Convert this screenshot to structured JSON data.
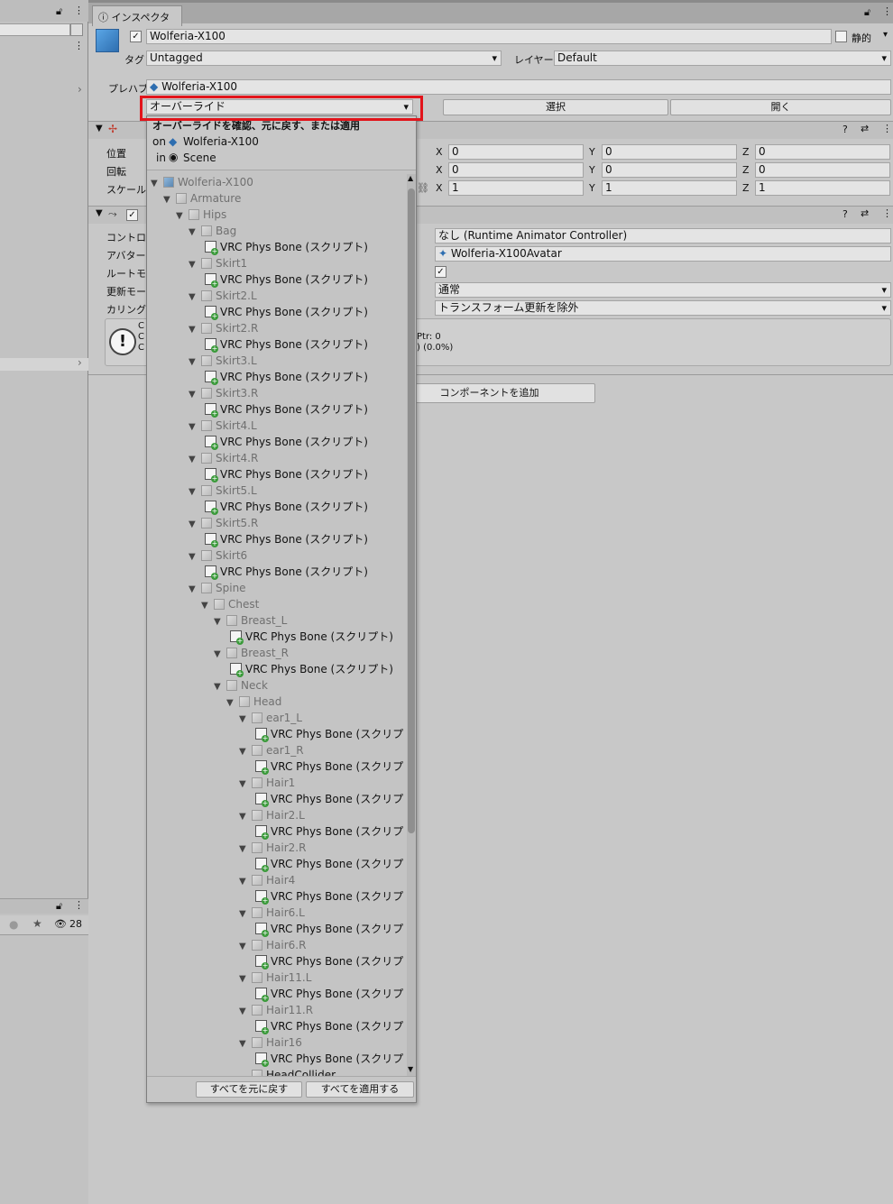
{
  "left": {
    "badge_count": "28"
  },
  "inspector": {
    "tab_label": "インスペクター",
    "object": {
      "name": "Wolferia-X100",
      "static_label": "静的"
    },
    "tag": {
      "label": "タグ",
      "value": "Untagged"
    },
    "layer": {
      "label": "レイヤー",
      "value": "Default"
    },
    "prefab": {
      "label": "プレハブ",
      "value": "Wolferia-X100",
      "overrides_label": "オーバーライド",
      "select_label": "選択",
      "open_label": "開く"
    },
    "transform": {
      "position_label": "位置",
      "rotation_label": "回転",
      "scale_label": "スケール",
      "position": [
        "0",
        "0",
        "0"
      ],
      "rotation": [
        "0",
        "0",
        "0"
      ],
      "scale": [
        "1",
        "1",
        "1"
      ],
      "axis_labels": [
        "X",
        "Y",
        "Z"
      ]
    },
    "animator": {
      "controller_label": "コントロー",
      "controller_value": "なし (Runtime Animator Controller)",
      "avatar_label": "アバター",
      "avatar_value": "Wolferia-X100Avatar",
      "root_motion_label": "ルートモー",
      "update_mode_label": "更新モー",
      "update_mode_value": "通常",
      "culling_label": "カリングモ",
      "culling_value": "トランスフォーム更新を除外",
      "info_text": [
        "C",
        "C",
        "C"
      ],
      "info_right": [
        "Ptr: 0",
        ") (0.0%)"
      ]
    },
    "add_component_label": "コンポーネントを追加"
  },
  "popup": {
    "heading": "オーバーライドを確認、元に戻す、または適用",
    "on_prefix": "on",
    "on_value": "Wolferia-X100",
    "in_prefix": "in",
    "in_value": "Scene",
    "revert_all_label": "すべてを元に戻す",
    "apply_all_label": "すべてを適用する",
    "tree": [
      {
        "depth": 0,
        "kind": "prefab",
        "label": "Wolferia-X100",
        "gray": true
      },
      {
        "depth": 1,
        "kind": "node",
        "label": "Armature",
        "gray": true
      },
      {
        "depth": 2,
        "kind": "node",
        "label": "Hips",
        "gray": true
      },
      {
        "depth": 3,
        "kind": "node",
        "label": "Bag",
        "gray": true
      },
      {
        "depth": 4,
        "kind": "script",
        "label": "VRC Phys Bone (スクリプト)"
      },
      {
        "depth": 3,
        "kind": "node",
        "label": "Skirt1",
        "gray": true
      },
      {
        "depth": 4,
        "kind": "script",
        "label": "VRC Phys Bone (スクリプト)"
      },
      {
        "depth": 3,
        "kind": "node",
        "label": "Skirt2.L",
        "gray": true
      },
      {
        "depth": 4,
        "kind": "script",
        "label": "VRC Phys Bone (スクリプト)"
      },
      {
        "depth": 3,
        "kind": "node",
        "label": "Skirt2.R",
        "gray": true
      },
      {
        "depth": 4,
        "kind": "script",
        "label": "VRC Phys Bone (スクリプト)"
      },
      {
        "depth": 3,
        "kind": "node",
        "label": "Skirt3.L",
        "gray": true
      },
      {
        "depth": 4,
        "kind": "script",
        "label": "VRC Phys Bone (スクリプト)"
      },
      {
        "depth": 3,
        "kind": "node",
        "label": "Skirt3.R",
        "gray": true
      },
      {
        "depth": 4,
        "kind": "script",
        "label": "VRC Phys Bone (スクリプト)"
      },
      {
        "depth": 3,
        "kind": "node",
        "label": "Skirt4.L",
        "gray": true
      },
      {
        "depth": 4,
        "kind": "script",
        "label": "VRC Phys Bone (スクリプト)"
      },
      {
        "depth": 3,
        "kind": "node",
        "label": "Skirt4.R",
        "gray": true
      },
      {
        "depth": 4,
        "kind": "script",
        "label": "VRC Phys Bone (スクリプト)"
      },
      {
        "depth": 3,
        "kind": "node",
        "label": "Skirt5.L",
        "gray": true
      },
      {
        "depth": 4,
        "kind": "script",
        "label": "VRC Phys Bone (スクリプト)"
      },
      {
        "depth": 3,
        "kind": "node",
        "label": "Skirt5.R",
        "gray": true
      },
      {
        "depth": 4,
        "kind": "script",
        "label": "VRC Phys Bone (スクリプト)"
      },
      {
        "depth": 3,
        "kind": "node",
        "label": "Skirt6",
        "gray": true
      },
      {
        "depth": 4,
        "kind": "script",
        "label": "VRC Phys Bone (スクリプト)"
      },
      {
        "depth": 3,
        "kind": "node",
        "label": "Spine",
        "gray": true
      },
      {
        "depth": 4,
        "kind": "node",
        "label": "Chest",
        "gray": true
      },
      {
        "depth": 5,
        "kind": "node",
        "label": "Breast_L",
        "gray": true
      },
      {
        "depth": 6,
        "kind": "script",
        "label": "VRC Phys Bone (スクリプト)"
      },
      {
        "depth": 5,
        "kind": "node",
        "label": "Breast_R",
        "gray": true
      },
      {
        "depth": 6,
        "kind": "script",
        "label": "VRC Phys Bone (スクリプト)"
      },
      {
        "depth": 5,
        "kind": "node",
        "label": "Neck",
        "gray": true
      },
      {
        "depth": 6,
        "kind": "node",
        "label": "Head",
        "gray": true
      },
      {
        "depth": 7,
        "kind": "node",
        "label": "ear1_L",
        "gray": true
      },
      {
        "depth": 8,
        "kind": "script",
        "label": "VRC Phys Bone (スクリプト"
      },
      {
        "depth": 7,
        "kind": "node",
        "label": "ear1_R",
        "gray": true
      },
      {
        "depth": 8,
        "kind": "script",
        "label": "VRC Phys Bone (スクリプト"
      },
      {
        "depth": 7,
        "kind": "node",
        "label": "Hair1",
        "gray": true
      },
      {
        "depth": 8,
        "kind": "script",
        "label": "VRC Phys Bone (スクリプト"
      },
      {
        "depth": 7,
        "kind": "node",
        "label": "Hair2.L",
        "gray": true
      },
      {
        "depth": 8,
        "kind": "script",
        "label": "VRC Phys Bone (スクリプト"
      },
      {
        "depth": 7,
        "kind": "node",
        "label": "Hair2.R",
        "gray": true
      },
      {
        "depth": 8,
        "kind": "script",
        "label": "VRC Phys Bone (スクリプト"
      },
      {
        "depth": 7,
        "kind": "node",
        "label": "Hair4",
        "gray": true
      },
      {
        "depth": 8,
        "kind": "script",
        "label": "VRC Phys Bone (スクリプト"
      },
      {
        "depth": 7,
        "kind": "node",
        "label": "Hair6.L",
        "gray": true
      },
      {
        "depth": 8,
        "kind": "script",
        "label": "VRC Phys Bone (スクリプト"
      },
      {
        "depth": 7,
        "kind": "node",
        "label": "Hair6.R",
        "gray": true
      },
      {
        "depth": 8,
        "kind": "script",
        "label": "VRC Phys Bone (スクリプト"
      },
      {
        "depth": 7,
        "kind": "node",
        "label": "Hair11.L",
        "gray": true
      },
      {
        "depth": 8,
        "kind": "script",
        "label": "VRC Phys Bone (スクリプト"
      },
      {
        "depth": 7,
        "kind": "node",
        "label": "Hair11.R",
        "gray": true
      },
      {
        "depth": 8,
        "kind": "script",
        "label": "VRC Phys Bone (スクリプト"
      },
      {
        "depth": 7,
        "kind": "node",
        "label": "Hair16",
        "gray": true
      },
      {
        "depth": 8,
        "kind": "script",
        "label": "VRC Phys Bone (スクリプト"
      },
      {
        "depth": 7,
        "kind": "collider",
        "label": "HeadCollider"
      }
    ]
  },
  "colors": {
    "highlight": "#e2141b",
    "panel": "#c8c8c8"
  }
}
